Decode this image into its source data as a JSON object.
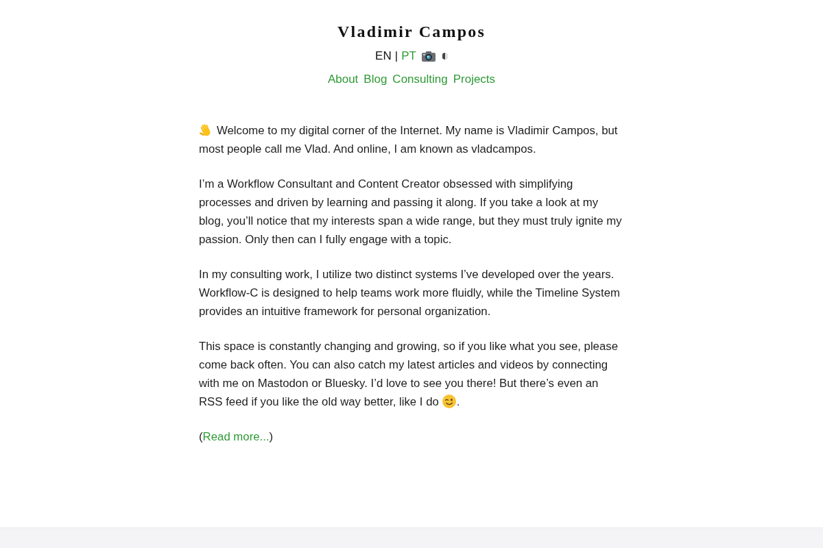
{
  "site_title": "Vladimir Campos",
  "languages": [
    {
      "label": "EN",
      "selected": true
    },
    {
      "label": "PT",
      "selected": false
    }
  ],
  "language_separator": "|",
  "nav": [
    "About",
    "Blog",
    "Consulting",
    "Projects"
  ],
  "paragraphs": [
    {
      "kind": "greeting",
      "text": "Welcome to my digital corner of the Internet. My name is Vladimir Campos, but most people call me Vlad. And online, I am known as vladcampos."
    },
    {
      "kind": "plain",
      "text": "I’m a Workflow Consultant and Content Creator obsessed with simplifying processes and driven by learning and passing it along. If you take a look at my blog, you’ll notice that my interests span a wide range, but they must truly ignite my passion. Only then can I fully engage with a topic."
    },
    {
      "kind": "plain",
      "text": "In my consulting work, I utilize two distinct systems I’ve developed over the years. Workflow-C is designed to help teams work more fluidly, while the Timeline System provides an intuitive framework for personal organization."
    },
    {
      "kind": "wink",
      "text": "This space is constantly changing and growing, so if you like what you see, please come back often. You can also catch my latest articles and videos by connecting with me on Mastodon or Bluesky. I’d love to see you there! But there’s even an RSS feed if you like the old way better, like I do",
      "after": "."
    },
    {
      "kind": "more",
      "before": "(",
      "link": "Read more...",
      "after": ")"
    }
  ]
}
